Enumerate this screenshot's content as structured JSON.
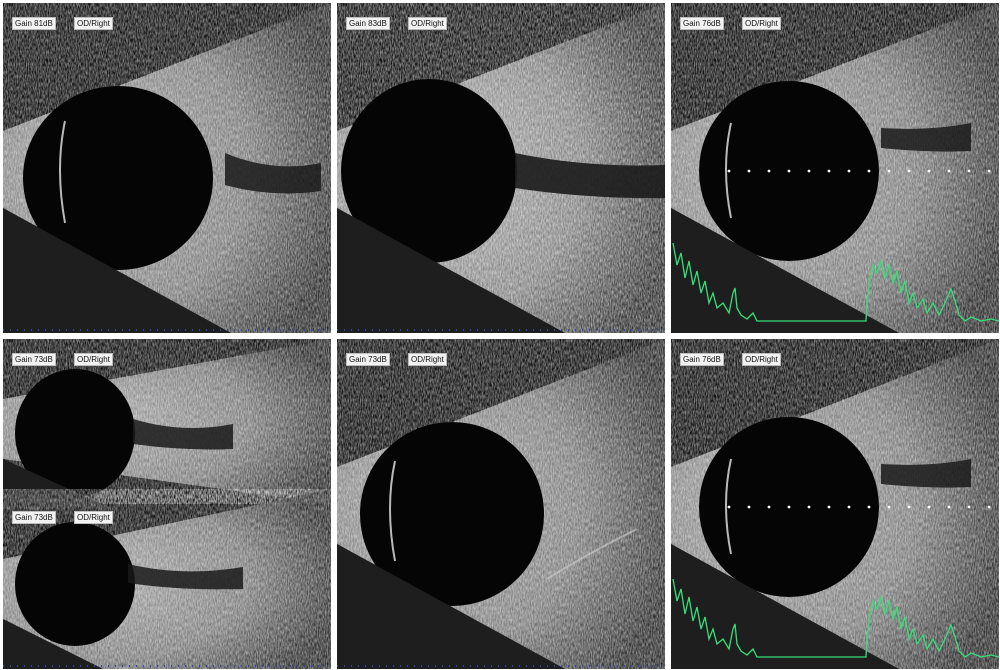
{
  "panels": [
    {
      "gain": "Gain 81dB",
      "eye": "OD/Right"
    },
    {
      "gain": "Gain 83dB",
      "eye": "OD/Right"
    },
    {
      "gain": "Gain 76dB",
      "eye": "OD/Right"
    },
    {
      "gain": "Gain 73dB",
      "eye": "OD/Right",
      "gain2": "Gain 73dB",
      "eye2": "OD/Right"
    },
    {
      "gain": "Gain 73dB",
      "eye": "OD/Right"
    },
    {
      "gain": "Gain 76dB",
      "eye": "OD/Right"
    }
  ],
  "colors": {
    "background": "#0b0b0b",
    "trace": "#35e07a",
    "scale": "#2a4aa8",
    "label_bg": "#f2f2f2"
  }
}
